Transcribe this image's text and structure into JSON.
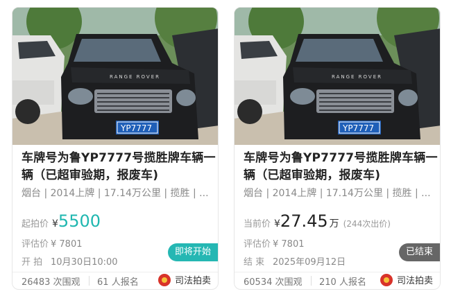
{
  "listings": [
    {
      "plate": "YP7777",
      "title": "车牌号为鲁YP7777号揽胜牌车辆一辆（已超审验期，报废车)",
      "meta": "烟台 | 2014上牌 | 17.14万公里 | 揽胜 | ...",
      "price_label": "起拍价",
      "price_currency": "¥",
      "price_value": "5500",
      "price_unit": "",
      "bids": "",
      "eval_label": "评估价",
      "eval_value": "¥ 7801",
      "time_label": "开  拍",
      "time_value": "10月30日10:00",
      "status_badge": "即将开始",
      "views_count": "26483",
      "views_suffix": "次围观",
      "signups_count": "61",
      "signups_suffix": "人报名",
      "seller": "司法拍卖"
    },
    {
      "plate": "YP7777",
      "title": "车牌号为鲁YP7777号揽胜牌车辆一辆（已超审验期，报废车)",
      "meta": "烟台 | 2014上牌 | 17.14万公里 | 揽胜 | ...",
      "price_label": "当前价",
      "price_currency": "¥",
      "price_value": "27.45",
      "price_unit": "万",
      "bids": "(244次出价)",
      "eval_label": "评估价",
      "eval_value": "¥ 7801",
      "time_label": "结  束",
      "time_value": "2025年09月12日",
      "status_badge": "已结束",
      "views_count": "60534",
      "views_suffix": "次围观",
      "signups_count": "210",
      "signups_suffix": "人报名",
      "seller": "司法拍卖"
    }
  ],
  "colors": {
    "accent_teal": "#25b7b3",
    "ended_gray": "#666666",
    "plate_blue": "#1f5fb8"
  }
}
